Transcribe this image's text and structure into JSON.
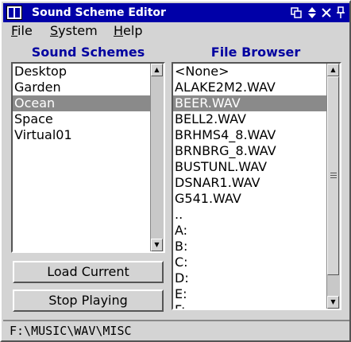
{
  "window": {
    "title": "Sound Scheme Editor"
  },
  "menu": [
    {
      "label": "File",
      "u": "F",
      "rest": "ile"
    },
    {
      "label": "System",
      "u": "S",
      "rest": "ystem"
    },
    {
      "label": "Help",
      "u": "H",
      "rest": "elp"
    }
  ],
  "schemes": {
    "title": "Sound Schemes",
    "items": [
      "Desktop",
      "Garden",
      "Ocean",
      "Space",
      "Virtual01"
    ],
    "selected": "Ocean"
  },
  "browser": {
    "title": "File Browser",
    "items": [
      "<None>",
      "ALAKE2M2.WAV",
      "BEER.WAV",
      "BELL2.WAV",
      "BRHMS4_8.WAV",
      "BRNBRG_8.WAV",
      "BUSTUNL.WAV",
      "DSNAR1.WAV",
      "G541.WAV",
      "..",
      "A:",
      "B:",
      "C:",
      "D:",
      "E:",
      "F:"
    ],
    "selected": "BEER.WAV"
  },
  "buttons": {
    "load_current": "Load Current",
    "stop_playing": "Stop Playing"
  },
  "status": {
    "path": "F:\\MUSIC\\WAV\\MISC"
  },
  "colors": {
    "titlebar": "#0000a8",
    "selection": "#8a8a8a",
    "section_title": "#0000a0"
  }
}
